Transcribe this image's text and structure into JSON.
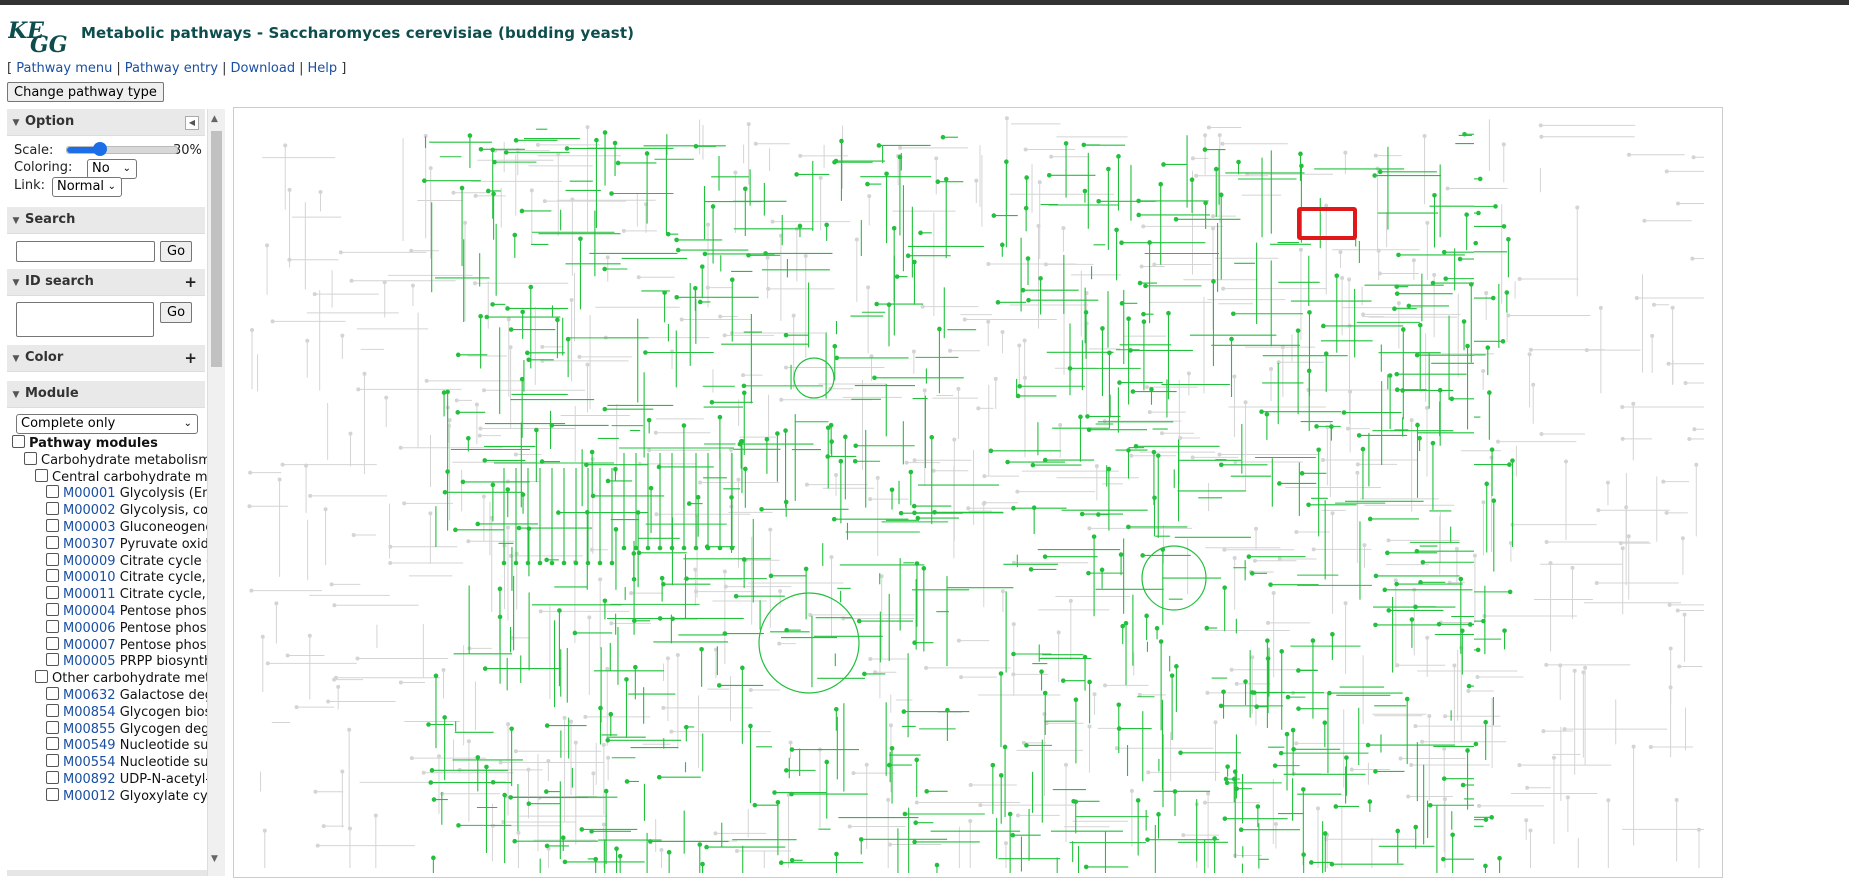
{
  "header": {
    "logo_text": "KEGG",
    "title": "Metabolic pathways - Saccharomyces cerevisiae (budding yeast)"
  },
  "nav": {
    "open_bracket": "[",
    "close_bracket": "]",
    "separator": "|",
    "links": [
      "Pathway menu",
      "Pathway entry",
      "Download",
      "Help"
    ]
  },
  "change_pathway_button": "Change pathway type",
  "panel": {
    "option": {
      "heading": "Option",
      "scale_label": "Scale:",
      "scale_value": "30%",
      "scale_fraction": 0.3,
      "coloring_label": "Coloring:",
      "coloring_value": "No",
      "link_label": "Link:",
      "link_value": "Normal"
    },
    "search": {
      "heading": "Search",
      "value": "",
      "go": "Go"
    },
    "id_search": {
      "heading": "ID search",
      "value": "",
      "go": "Go"
    },
    "color": {
      "heading": "Color"
    },
    "module": {
      "heading": "Module",
      "filter_value": "Complete only",
      "tree": [
        {
          "level": 0,
          "label": "Pathway modules",
          "bold": true
        },
        {
          "level": 1,
          "label": "Carbohydrate metabolism"
        },
        {
          "level": 2,
          "label": "Central carbohydrate me"
        },
        {
          "level": 3,
          "id": "M00001",
          "label": "Glycolysis (Em"
        },
        {
          "level": 3,
          "id": "M00002",
          "label": "Glycolysis, co"
        },
        {
          "level": 3,
          "id": "M00003",
          "label": "Gluconeogene"
        },
        {
          "level": 3,
          "id": "M00307",
          "label": "Pyruvate oxid"
        },
        {
          "level": 3,
          "id": "M00009",
          "label": "Citrate cycle ("
        },
        {
          "level": 3,
          "id": "M00010",
          "label": "Citrate cycle,"
        },
        {
          "level": 3,
          "id": "M00011",
          "label": "Citrate cycle,"
        },
        {
          "level": 3,
          "id": "M00004",
          "label": "Pentose phos"
        },
        {
          "level": 3,
          "id": "M00006",
          "label": "Pentose phos"
        },
        {
          "level": 3,
          "id": "M00007",
          "label": "Pentose phos"
        },
        {
          "level": 3,
          "id": "M00005",
          "label": "PRPP biosynth"
        },
        {
          "level": 2,
          "label": "Other carbohydrate met"
        },
        {
          "level": 3,
          "id": "M00632",
          "label": "Galactose deg"
        },
        {
          "level": 3,
          "id": "M00854",
          "label": "Glycogen bios"
        },
        {
          "level": 3,
          "id": "M00855",
          "label": "Glycogen degr"
        },
        {
          "level": 3,
          "id": "M00549",
          "label": "Nucleotide su"
        },
        {
          "level": 3,
          "id": "M00554",
          "label": "Nucleotide su"
        },
        {
          "level": 3,
          "id": "M00892",
          "label": "UDP-N-acetyl-"
        },
        {
          "level": 3,
          "id": "M00012",
          "label": "Glyoxylate cy"
        }
      ]
    }
  },
  "map": {
    "active_color": "#22c03c",
    "inactive_color": "#d4d4d4",
    "highlight_color": "#e01818"
  }
}
